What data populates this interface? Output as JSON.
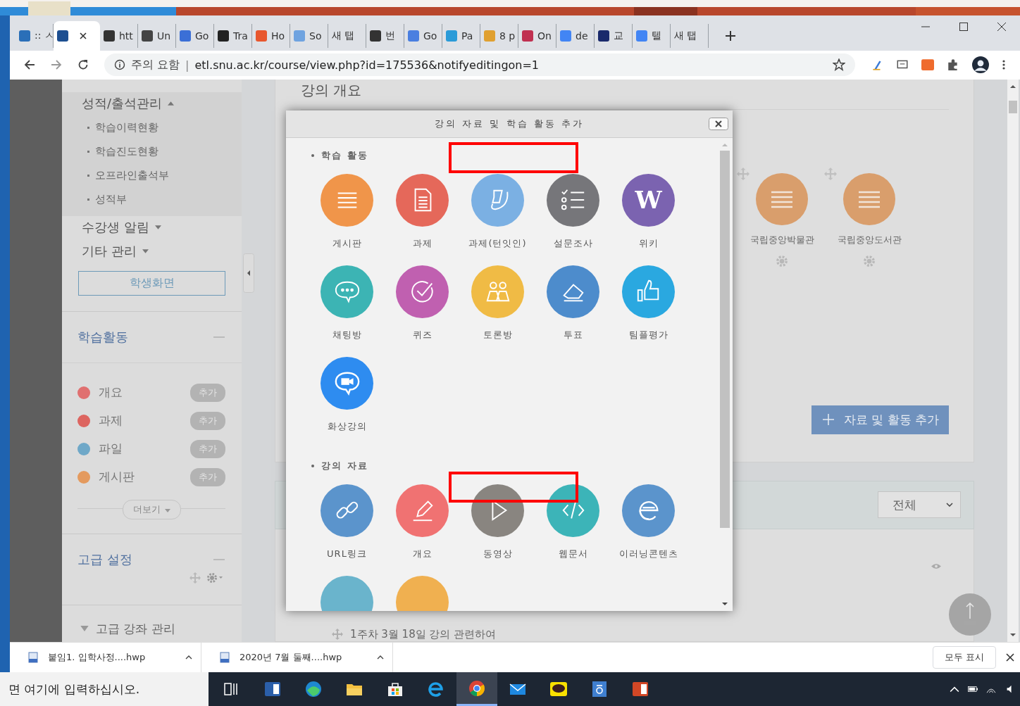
{
  "browser": {
    "tabs": [
      {
        "label": ":: ㅅ",
        "selected": false,
        "color": "#2a6fb8"
      },
      {
        "selected": true,
        "color": "#1d4f91"
      },
      {
        "label": "htt",
        "selected": false,
        "color": "#333333"
      },
      {
        "label": "Un",
        "selected": false,
        "color": "#444444"
      },
      {
        "label": "Go",
        "selected": false,
        "color": "#3b6fd6"
      },
      {
        "label": "Tra",
        "selected": false,
        "color": "#222222"
      },
      {
        "label": "Ho",
        "selected": false,
        "color": "#e8572e"
      },
      {
        "label": "So",
        "selected": false,
        "color": "#6fa3e0"
      },
      {
        "label": "새 탭",
        "selected": false
      },
      {
        "label": "번",
        "selected": false,
        "color": "#333333"
      },
      {
        "label": "Go",
        "selected": false,
        "color": "#4a7fe0"
      },
      {
        "label": "Pa",
        "selected": false,
        "color": "#2a9bd8"
      },
      {
        "label": "8 p",
        "selected": false,
        "color": "#e0a030"
      },
      {
        "label": "On",
        "selected": false,
        "color": "#c03050"
      },
      {
        "label": "de",
        "selected": false,
        "color": "#4285f4"
      },
      {
        "label": "교",
        "selected": false,
        "color": "#1a2a6c"
      },
      {
        "label": "텔",
        "selected": false,
        "color": "#4285f4"
      },
      {
        "label": "새 탭",
        "selected": false
      }
    ],
    "address": {
      "security": "주의 요함",
      "separator": "|",
      "url": "etl.snu.ac.kr/course/view.php?id=175536&notifyeditingon=1"
    }
  },
  "sidebar": {
    "menus": [
      {
        "label": "성적/출석관리",
        "expanded": true,
        "children": [
          {
            "label": "학습이력현황"
          },
          {
            "label": "학습진도현황"
          },
          {
            "label": "오프라인출석부"
          },
          {
            "label": "성적부"
          }
        ]
      },
      {
        "label": "수강생 알림",
        "expanded": false
      },
      {
        "label": "기타 관리",
        "expanded": false
      }
    ],
    "student_view_button": "학생화면",
    "activities": {
      "title": "학습활동",
      "items": [
        {
          "label": "개요",
          "color": "#e07070",
          "badge": "추가"
        },
        {
          "label": "과제",
          "color": "#dd6560",
          "badge": "추가"
        },
        {
          "label": "파일",
          "color": "#6fa8c8",
          "badge": "추가"
        },
        {
          "label": "게시판",
          "color": "#e49a5e",
          "badge": "추가"
        }
      ],
      "more": "더보기"
    },
    "advanced": {
      "title": "고급 설정"
    },
    "course_admin": {
      "label": "고급 강좌 관리",
      "expanded": true
    }
  },
  "main": {
    "heading": "강의 개요",
    "resources": [
      {
        "label": "국립중앙박물관"
      },
      {
        "label": "국립중앙도서관"
      }
    ],
    "add_button": "자료 및 활동 추가",
    "filter": {
      "value": "전체"
    },
    "week_title": "1주차 3월 18일 강의 관련하여"
  },
  "modal": {
    "title": "강의 자료 및 학습 활동 추가",
    "sections": [
      {
        "title": "학습 활동",
        "items": [
          {
            "label": "게시판",
            "kind": "board",
            "color": "#f0954a"
          },
          {
            "label": "과제",
            "kind": "doc",
            "color": "#e5685a"
          },
          {
            "label": "과제(턴잇인)",
            "kind": "turnitin",
            "color": "#7bb0e3"
          },
          {
            "label": "설문조사",
            "kind": "survey",
            "color": "#76767a"
          },
          {
            "label": "위키",
            "kind": "wiki",
            "color": "#7b63b0",
            "glyph": "W"
          },
          {
            "label": "채팅방",
            "kind": "chat",
            "color": "#3cb4b4"
          },
          {
            "label": "퀴즈",
            "kind": "quiz",
            "color": "#c060b0"
          },
          {
            "label": "토론방",
            "kind": "discuss",
            "color": "#f0bb45"
          },
          {
            "label": "투표",
            "kind": "vote",
            "color": "#4d8ccc"
          },
          {
            "label": "팀플평가",
            "kind": "like",
            "color": "#2aa8e0"
          },
          {
            "label": "화상강의",
            "kind": "videochat",
            "color": "#2e8cf0"
          }
        ]
      },
      {
        "title": "강의 자료",
        "items": [
          {
            "label": "URL링크",
            "kind": "link",
            "color": "#5b94cc"
          },
          {
            "label": "개요",
            "kind": "pencil",
            "color": "#f07272"
          },
          {
            "label": "동영상",
            "kind": "play",
            "color": "#898580"
          },
          {
            "label": "웹문서",
            "kind": "code",
            "color": "#3cb4b8"
          },
          {
            "label": "이러닝콘텐츠",
            "kind": "ebook",
            "color": "#5b94cc"
          },
          {
            "kind": "blank",
            "color": "#6ab4cc"
          },
          {
            "kind": "blank",
            "color": "#f0b050"
          }
        ]
      }
    ]
  },
  "downloads": {
    "items": [
      {
        "name": "붙임1. 입학사정....hwp"
      },
      {
        "name": "2020년 7월 둘째....hwp"
      }
    ],
    "show_all": "모두 표시"
  },
  "taskbar": {
    "search_placeholder": "면 여기에 입력하십시오.",
    "apps": [
      {
        "kind": "taskview",
        "selected": false
      },
      {
        "kind": "word",
        "selected": false
      },
      {
        "kind": "edge",
        "selected": false
      },
      {
        "kind": "explorer",
        "selected": false
      },
      {
        "kind": "store",
        "selected": false
      },
      {
        "kind": "ie",
        "selected": false
      },
      {
        "kind": "chrome",
        "selected": true
      },
      {
        "kind": "mail",
        "selected": false
      },
      {
        "kind": "talk",
        "selected": false
      },
      {
        "kind": "hangul",
        "selected": false
      },
      {
        "kind": "ppt",
        "selected": false
      }
    ]
  }
}
